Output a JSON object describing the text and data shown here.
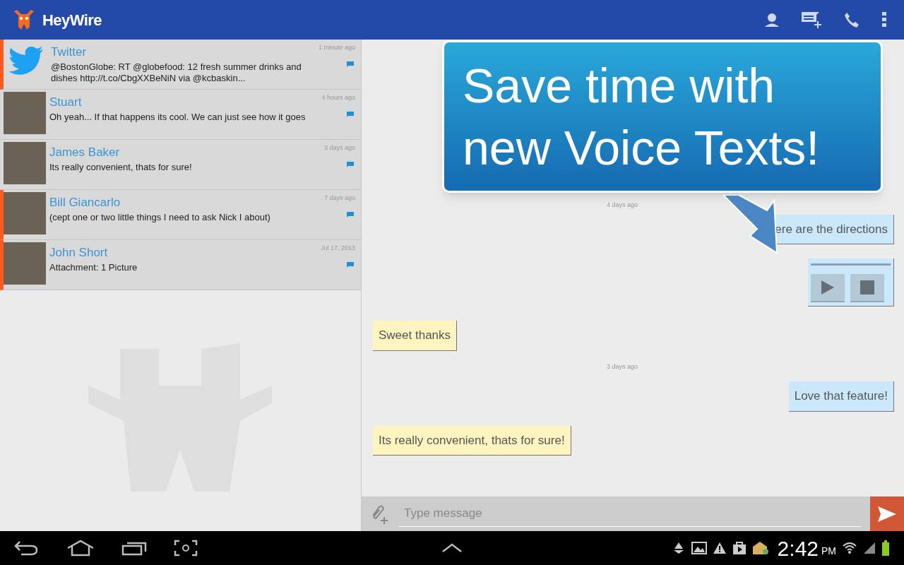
{
  "app_bar": {
    "title": "HeyWire"
  },
  "conversations": [
    {
      "name": "Twitter",
      "kind": "twitter",
      "time": "1 minute ago",
      "preview": "@BostonGlobe: RT @globefood: 12 fresh summer drinks and dishes http://t.co/CbgXXBeNiN via @kcbaskin...",
      "unread": true
    },
    {
      "name": "Stuart",
      "kind": "photo",
      "time": "4 hours ago",
      "preview": "Oh yeah... If that happens its cool. We can just see how it goes",
      "unread": false
    },
    {
      "name": "James Baker",
      "kind": "photo",
      "time": "3 days ago",
      "preview": "Its really convenient, thats for sure!",
      "unread": false
    },
    {
      "name": "Bill Giancarlo",
      "kind": "photo",
      "time": "7 days ago",
      "preview": "(cept one or two little things I need to ask Nick I about)",
      "unread": true
    },
    {
      "name": "John Short",
      "kind": "photo",
      "time": "Jul 17, 2013",
      "preview": "Attachment: 1 Picture",
      "unread": true
    }
  ],
  "messages": [
    {
      "kind": "timestamp",
      "text": "4 days ago"
    },
    {
      "kind": "outgoing",
      "text": "ere are the directions"
    },
    {
      "kind": "voice"
    },
    {
      "kind": "incoming",
      "text": "Sweet thanks"
    },
    {
      "kind": "timestamp",
      "text": "3 days ago"
    },
    {
      "kind": "outgoing",
      "text": "Love that feature!"
    },
    {
      "kind": "incoming",
      "text": "Its really convenient, thats for sure!"
    }
  ],
  "composer": {
    "placeholder": "Type message"
  },
  "callout": {
    "lines": [
      "Save time with",
      "new Voice Texts!"
    ]
  },
  "status_bar": {
    "time": "2:42",
    "ampm": "PM"
  }
}
